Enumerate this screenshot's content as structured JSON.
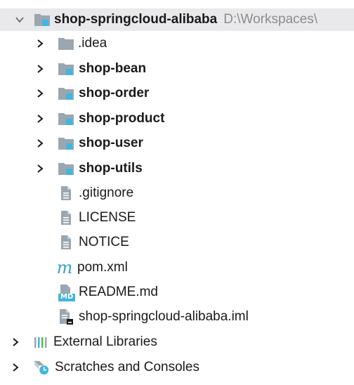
{
  "project": {
    "name": "shop-springcloud-alibaba",
    "path": "D:\\Workspaces\\"
  },
  "children": {
    "idea": ".idea",
    "shop_bean": "shop-bean",
    "shop_order": "shop-order",
    "shop_product": "shop-product",
    "shop_user": "shop-user",
    "shop_utils": "shop-utils",
    "gitignore": ".gitignore",
    "license": "LICENSE",
    "notice": "NOTICE",
    "pom": "pom.xml",
    "readme": "README.md",
    "iml": "shop-springcloud-alibaba.iml"
  },
  "roots": {
    "external_libraries": "External Libraries",
    "scratches": "Scratches and Consoles"
  },
  "icons": {
    "md_badge": "MD",
    "maven_glyph": "m"
  },
  "colors": {
    "selection": "#e9e9ec",
    "folder": "#9aa7b0",
    "module_badge": "#40b6e0",
    "path_text": "#8c8c8c"
  }
}
